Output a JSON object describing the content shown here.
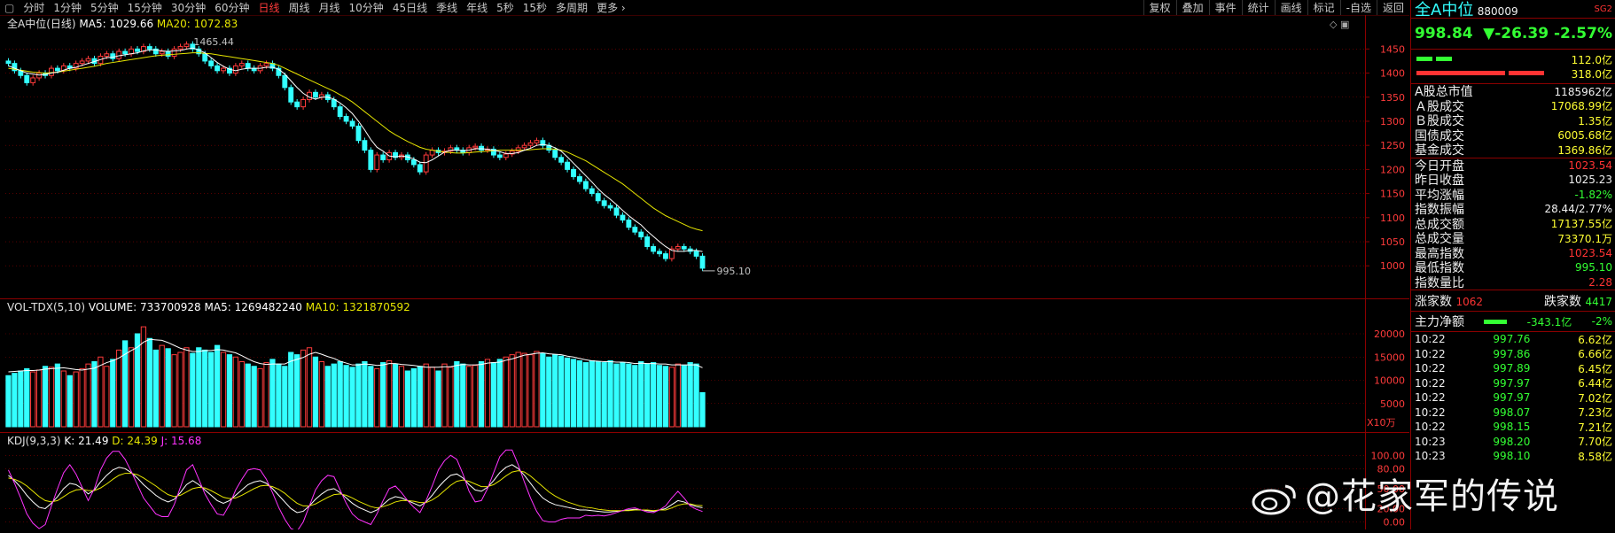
{
  "toolbar": {
    "periods": [
      "分时",
      "1分钟",
      "5分钟",
      "15分钟",
      "30分钟",
      "60分钟",
      "日线",
      "周线",
      "月线",
      "10分钟",
      "45日线",
      "季线",
      "年线",
      "5秒",
      "15秒",
      "多周期",
      "更多"
    ],
    "active_period": "日线",
    "tools": [
      "复权",
      "叠加",
      "事件",
      "统计",
      "画线",
      "标记",
      "-自选",
      "返回"
    ]
  },
  "header": {
    "title": "全A中位(日线)",
    "ma5_label": "MA5: 1029.66",
    "ma20_label": "MA20: 1072.83"
  },
  "price_labels": {
    "high": "1465.44",
    "low": "995.10"
  },
  "vol_header": {
    "name": "VOL-TDX(5,10)",
    "volume": "VOLUME: 733700928",
    "ma5": "MA5: 1269482240",
    "ma10": "MA10: 1321870592"
  },
  "vol_unit": "X10万",
  "kdj_header": {
    "name": "KDJ(9,3,3)",
    "k": "K: 21.49",
    "d": "D: 24.39",
    "j": "J: 15.68"
  },
  "colors": {
    "up": "#ff3b3b",
    "down": "#33ffff",
    "ma5": "#ffffff",
    "ma20": "#e6e600",
    "j": "#ff33ff",
    "grid": "#8b0000"
  },
  "chart_data": [
    {
      "type": "candlestick",
      "title": "全A中位(日线)",
      "ylim": [
        960,
        1480
      ],
      "yticks": [
        1000,
        1050,
        1100,
        1150,
        1200,
        1250,
        1300,
        1350,
        1400,
        1450
      ],
      "close": [
        1420,
        1405,
        1395,
        1380,
        1390,
        1400,
        1395,
        1410,
        1405,
        1415,
        1410,
        1420,
        1425,
        1430,
        1420,
        1435,
        1440,
        1430,
        1445,
        1440,
        1450,
        1445,
        1455,
        1450,
        1440,
        1445,
        1435,
        1450,
        1455,
        1460,
        1450,
        1440,
        1425,
        1415,
        1405,
        1410,
        1400,
        1415,
        1420,
        1410,
        1405,
        1415,
        1420,
        1410,
        1395,
        1370,
        1340,
        1330,
        1345,
        1360,
        1350,
        1355,
        1345,
        1330,
        1310,
        1300,
        1290,
        1260,
        1240,
        1200,
        1230,
        1220,
        1235,
        1225,
        1230,
        1220,
        1210,
        1195,
        1230,
        1240,
        1235,
        1238,
        1245,
        1240,
        1235,
        1245,
        1248,
        1240,
        1242,
        1230,
        1225,
        1232,
        1238,
        1245,
        1250,
        1255,
        1260,
        1250,
        1240,
        1225,
        1215,
        1200,
        1185,
        1175,
        1160,
        1150,
        1135,
        1125,
        1120,
        1105,
        1095,
        1080,
        1070,
        1060,
        1040,
        1030,
        1025,
        1015,
        1035,
        1040,
        1035,
        1030,
        1020,
        995.1
      ],
      "ma5": [
        1415,
        1410,
        1405,
        1400,
        1398,
        1396,
        1397,
        1400,
        1402,
        1406,
        1410,
        1412,
        1416,
        1420,
        1424,
        1428,
        1432,
        1433,
        1436,
        1438,
        1440,
        1442,
        1446,
        1448,
        1448,
        1446,
        1445,
        1446,
        1447,
        1450,
        1452,
        1448,
        1442,
        1432,
        1422,
        1414,
        1408,
        1405,
        1408,
        1410,
        1410,
        1410,
        1412,
        1412,
        1408,
        1398,
        1384,
        1370,
        1358,
        1350,
        1346,
        1350,
        1350,
        1346,
        1338,
        1328,
        1316,
        1300,
        1282,
        1262,
        1246,
        1238,
        1228,
        1226,
        1228,
        1226,
        1222,
        1215,
        1214,
        1220,
        1228,
        1236,
        1240,
        1240,
        1239,
        1240,
        1243,
        1243,
        1242,
        1240,
        1237,
        1233,
        1233,
        1235,
        1240,
        1244,
        1250,
        1252,
        1250,
        1245,
        1238,
        1226,
        1213,
        1200,
        1187,
        1174,
        1160,
        1148,
        1138,
        1127,
        1115,
        1104,
        1094,
        1085,
        1072,
        1061,
        1050,
        1040,
        1032,
        1030,
        1030,
        1032,
        1032,
        1029.66
      ],
      "ma20": [
        1410,
        1408,
        1406,
        1404,
        1402,
        1401,
        1400,
        1401,
        1402,
        1404,
        1406,
        1408,
        1410,
        1412,
        1414,
        1417,
        1420,
        1422,
        1424,
        1426,
        1428,
        1430,
        1432,
        1434,
        1436,
        1437,
        1438,
        1439,
        1440,
        1441,
        1442,
        1442,
        1441,
        1440,
        1438,
        1436,
        1434,
        1432,
        1430,
        1428,
        1426,
        1424,
        1422,
        1420,
        1416,
        1410,
        1404,
        1398,
        1392,
        1386,
        1380,
        1374,
        1368,
        1362,
        1355,
        1348,
        1340,
        1330,
        1320,
        1310,
        1300,
        1290,
        1280,
        1272,
        1265,
        1258,
        1252,
        1246,
        1242,
        1240,
        1238,
        1236,
        1235,
        1234,
        1234,
        1235,
        1236,
        1237,
        1238,
        1239,
        1240,
        1240,
        1240,
        1240,
        1240,
        1241,
        1242,
        1243,
        1243,
        1242,
        1240,
        1236,
        1230,
        1224,
        1218,
        1210,
        1202,
        1194,
        1186,
        1178,
        1170,
        1160,
        1150,
        1140,
        1130,
        1120,
        1112,
        1104,
        1098,
        1092,
        1086,
        1080,
        1076,
        1072.83
      ]
    },
    {
      "type": "bar",
      "title": "VOL-TDX(5,10)",
      "unit": "X10万",
      "ylim": [
        0,
        24000
      ],
      "yticks": [
        5000,
        10000,
        15000,
        20000
      ],
      "values": [
        11000,
        11500,
        12000,
        12500,
        11800,
        12200,
        13000,
        12800,
        13500,
        12000,
        11000,
        11800,
        12500,
        13500,
        14000,
        15000,
        13000,
        14500,
        16500,
        18500,
        17000,
        20000,
        21500,
        19000,
        16500,
        17500,
        16800,
        15500,
        16000,
        17000,
        15800,
        17000,
        16500,
        16000,
        17500,
        16000,
        15500,
        15000,
        14000,
        13500,
        13000,
        12500,
        13800,
        14500,
        13500,
        13000,
        16000,
        15500,
        16500,
        17000,
        15000,
        14000,
        13000,
        13500,
        14000,
        13200,
        12800,
        13500,
        14000,
        13000,
        12500,
        13800,
        14200,
        13500,
        13000,
        12000,
        12500,
        13000,
        13500,
        12800,
        12000,
        13500,
        12800,
        14000,
        13500,
        13000,
        13200,
        14000,
        14500,
        13800,
        14500,
        15000,
        15500,
        16000,
        15800,
        15500,
        16200,
        15800,
        15000,
        15500,
        15200,
        14800,
        14500,
        14200,
        13800,
        14200,
        14000,
        13800,
        14200,
        13500,
        13800,
        13500,
        13200,
        14000,
        13500,
        13800,
        13200,
        13000,
        12800,
        13500,
        13200,
        13800,
        13500,
        7337
      ],
      "ma5": [
        11800,
        11900,
        12000,
        12100,
        12100,
        12200,
        12400,
        12500,
        12600,
        12700,
        12500,
        12300,
        12200,
        12400,
        12600,
        13200,
        13800,
        14200,
        14800,
        15600,
        16400,
        17100,
        18200,
        18800,
        18700,
        18600,
        18100,
        17500,
        16900,
        16500,
        16200,
        16200,
        16400,
        16400,
        16600,
        16500,
        16200,
        15900,
        15300,
        14600,
        14000,
        13600,
        13400,
        13500,
        13500,
        13500,
        14100,
        14500,
        14900,
        15600,
        16000,
        15600,
        15100,
        14700,
        14100,
        13700,
        13300,
        13300,
        13500,
        13400,
        13200,
        13300,
        13600,
        13600,
        13400,
        13300,
        13200,
        13000,
        12800,
        12800,
        12800,
        12900,
        12900,
        13200,
        13400,
        13300,
        13300,
        13400,
        13700,
        13800,
        13900,
        14300,
        14600,
        15000,
        15400,
        15600,
        15800,
        15900,
        15700,
        15600,
        15500,
        15200,
        15000,
        14700,
        14400,
        14200,
        14100,
        14000,
        14000,
        13900,
        13900,
        13800,
        13600,
        13700,
        13600,
        13600,
        13500,
        13500,
        13300,
        13300,
        13300,
        13300,
        13300,
        12695
      ]
    },
    {
      "type": "line",
      "title": "KDJ(9,3,3)",
      "ylim": [
        -10,
        115
      ],
      "yticks": [
        0,
        20,
        50,
        80,
        100
      ],
      "series": [
        {
          "name": "K",
          "values": [
            70,
            62,
            52,
            40,
            30,
            22,
            20,
            28,
            38,
            50,
            58,
            56,
            50,
            42,
            48,
            60,
            70,
            78,
            82,
            80,
            74,
            66,
            56,
            48,
            40,
            34,
            30,
            34,
            44,
            56,
            62,
            56,
            48,
            40,
            32,
            28,
            32,
            40,
            48,
            56,
            60,
            62,
            58,
            50,
            40,
            30,
            20,
            14,
            16,
            24,
            34,
            42,
            48,
            50,
            44,
            36,
            28,
            22,
            18,
            14,
            18,
            26,
            34,
            38,
            36,
            32,
            28,
            24,
            30,
            40,
            52,
            62,
            70,
            72,
            66,
            56,
            48,
            46,
            52,
            62,
            74,
            82,
            86,
            80,
            70,
            58,
            46,
            36,
            30,
            26,
            24,
            22,
            20,
            18,
            18,
            17,
            16,
            15,
            15,
            16,
            17,
            18,
            19,
            18,
            17,
            16,
            18,
            20,
            26,
            32,
            30,
            26,
            23,
            21.49
          ]
        },
        {
          "name": "D",
          "values": [
            66,
            64,
            60,
            54,
            46,
            38,
            32,
            30,
            32,
            38,
            44,
            48,
            49,
            47,
            47,
            51,
            57,
            64,
            70,
            73,
            73,
            71,
            66,
            60,
            54,
            47,
            41,
            38,
            40,
            45,
            50,
            52,
            51,
            47,
            42,
            37,
            35,
            36,
            40,
            45,
            50,
            54,
            55,
            53,
            49,
            43,
            35,
            28,
            24,
            24,
            27,
            32,
            37,
            41,
            42,
            40,
            36,
            31,
            27,
            23,
            21,
            23,
            26,
            30,
            32,
            32,
            31,
            29,
            29,
            33,
            39,
            47,
            55,
            61,
            63,
            61,
            57,
            53,
            53,
            56,
            62,
            69,
            75,
            77,
            75,
            69,
            61,
            53,
            45,
            39,
            34,
            30,
            27,
            24,
            22,
            21,
            19,
            18,
            17,
            17,
            17,
            17,
            18,
            18,
            18,
            17,
            18,
            18,
            21,
            25,
            27,
            27,
            25,
            24.39
          ]
        },
        {
          "name": "J",
          "values": [
            78,
            58,
            36,
            12,
            -2,
            -10,
            -4,
            24,
            50,
            74,
            86,
            72,
            52,
            32,
            50,
            78,
            96,
            106,
            106,
            94,
            76,
            56,
            36,
            24,
            12,
            8,
            8,
            26,
            52,
            78,
            86,
            64,
            42,
            26,
            12,
            10,
            26,
            48,
            64,
            78,
            80,
            78,
            64,
            44,
            22,
            4,
            -10,
            -14,
            0,
            24,
            48,
            62,
            70,
            68,
            48,
            28,
            12,
            4,
            0,
            -4,
            12,
            32,
            50,
            54,
            44,
            32,
            22,
            14,
            32,
            54,
            78,
            92,
            100,
            94,
            72,
            46,
            30,
            32,
            50,
            74,
            98,
            108,
            108,
            86,
            60,
            36,
            16,
            2,
            0,
            0,
            4,
            6,
            6,
            6,
            10,
            9,
            10,
            9,
            11,
            14,
            17,
            20,
            21,
            18,
            15,
            14,
            18,
            24,
            36,
            46,
            36,
            24,
            19,
            15.68
          ]
        }
      ]
    }
  ],
  "sidebar": {
    "name": "全A中位",
    "code": "880009",
    "flag": "SG2",
    "price": "998.84",
    "change": "▼-26.39",
    "pct": "-2.57%",
    "flow_in": "112.0亿",
    "flow_out": "318.0亿",
    "stats": [
      {
        "label": "A股总市值",
        "value": "1185962亿",
        "color": "white"
      },
      {
        "label": "Ａ股成交",
        "value": "17068.99亿",
        "color": "yellow"
      },
      {
        "label": "Ｂ股成交",
        "value": "1.35亿",
        "color": "yellow"
      },
      {
        "label": "国债成交",
        "value": "6005.68亿",
        "color": "yellow"
      },
      {
        "label": "基金成交",
        "value": "1369.86亿",
        "color": "yellow"
      }
    ],
    "quotes": [
      {
        "label": "今日开盘",
        "value": "1023.54",
        "color": "red"
      },
      {
        "label": "昨日收盘",
        "value": "1025.23",
        "color": "white"
      },
      {
        "label": "平均涨幅",
        "value": "-1.82%",
        "color": "green"
      },
      {
        "label": "指数振幅",
        "value": "28.44/2.77%",
        "color": "white"
      },
      {
        "label": "总成交额",
        "value": "17137.55亿",
        "color": "yellow"
      },
      {
        "label": "总成交量",
        "value": "73370.1万",
        "color": "yellow"
      },
      {
        "label": "最高指数",
        "value": "1023.54",
        "color": "red"
      },
      {
        "label": "最低指数",
        "value": "995.10",
        "color": "green"
      },
      {
        "label": "指数量比",
        "value": "2.28",
        "color": "red"
      }
    ],
    "breadth": {
      "up_label": "涨家数",
      "up": "1062",
      "down_label": "跌家数",
      "down": "4417"
    },
    "mainflow": {
      "label": "主力净额",
      "value": "-343.1亿",
      "pct": "-2%"
    },
    "ticks": [
      {
        "time": "10:22",
        "price": "997.76",
        "amt": "6.62亿"
      },
      {
        "time": "10:22",
        "price": "997.86",
        "amt": "6.66亿"
      },
      {
        "time": "10:22",
        "price": "997.89",
        "amt": "6.45亿"
      },
      {
        "time": "10:22",
        "price": "997.97",
        "amt": "6.44亿"
      },
      {
        "time": "10:22",
        "price": "997.97",
        "amt": "7.02亿"
      },
      {
        "time": "10:22",
        "price": "998.07",
        "amt": "7.23亿"
      },
      {
        "time": "10:22",
        "price": "998.15",
        "amt": "7.21亿"
      },
      {
        "time": "10:23",
        "price": "998.20",
        "amt": "7.70亿"
      },
      {
        "time": "10:23",
        "price": "998.10",
        "amt": "8.58亿"
      }
    ]
  },
  "watermark": "@花家军的传说"
}
